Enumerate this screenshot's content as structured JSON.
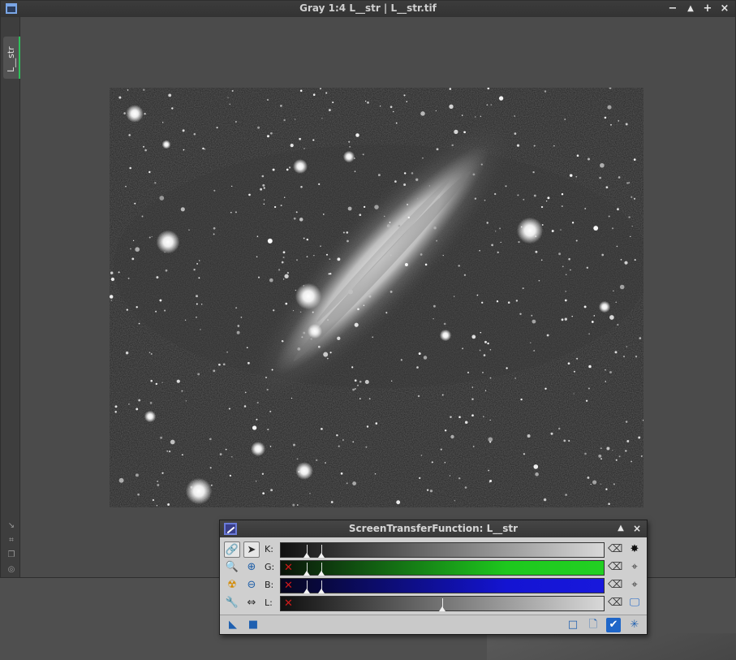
{
  "window": {
    "title": "Gray 1:4 L__str | L__str.tif",
    "view_tab": "L__str",
    "buttons": {
      "minimize": "−",
      "shade": "▲",
      "maximize": "+",
      "close": "×"
    }
  },
  "side_tools": [
    "shrink-icon",
    "fit-icon",
    "clone-icon",
    "target-icon"
  ],
  "stf": {
    "title": "ScreenTransferFunction: L__str",
    "channels": [
      {
        "label": "K:",
        "bar": "gray",
        "disabled": false
      },
      {
        "label": "G:",
        "bar": "green",
        "disabled": true
      },
      {
        "label": "B:",
        "bar": "blue",
        "disabled": true
      },
      {
        "label": "L:",
        "bar": "gray",
        "disabled": true
      }
    ],
    "midtones": {
      "K": 0.125,
      "G": 0.125,
      "B": 0.125,
      "L": 0.5
    },
    "shadows": {
      "K": 0.08,
      "G": 0.08,
      "B": 0.08
    },
    "colors": {
      "green": "#1ec81e",
      "blue": "#1414d2",
      "accent": "#1f66c8"
    }
  }
}
